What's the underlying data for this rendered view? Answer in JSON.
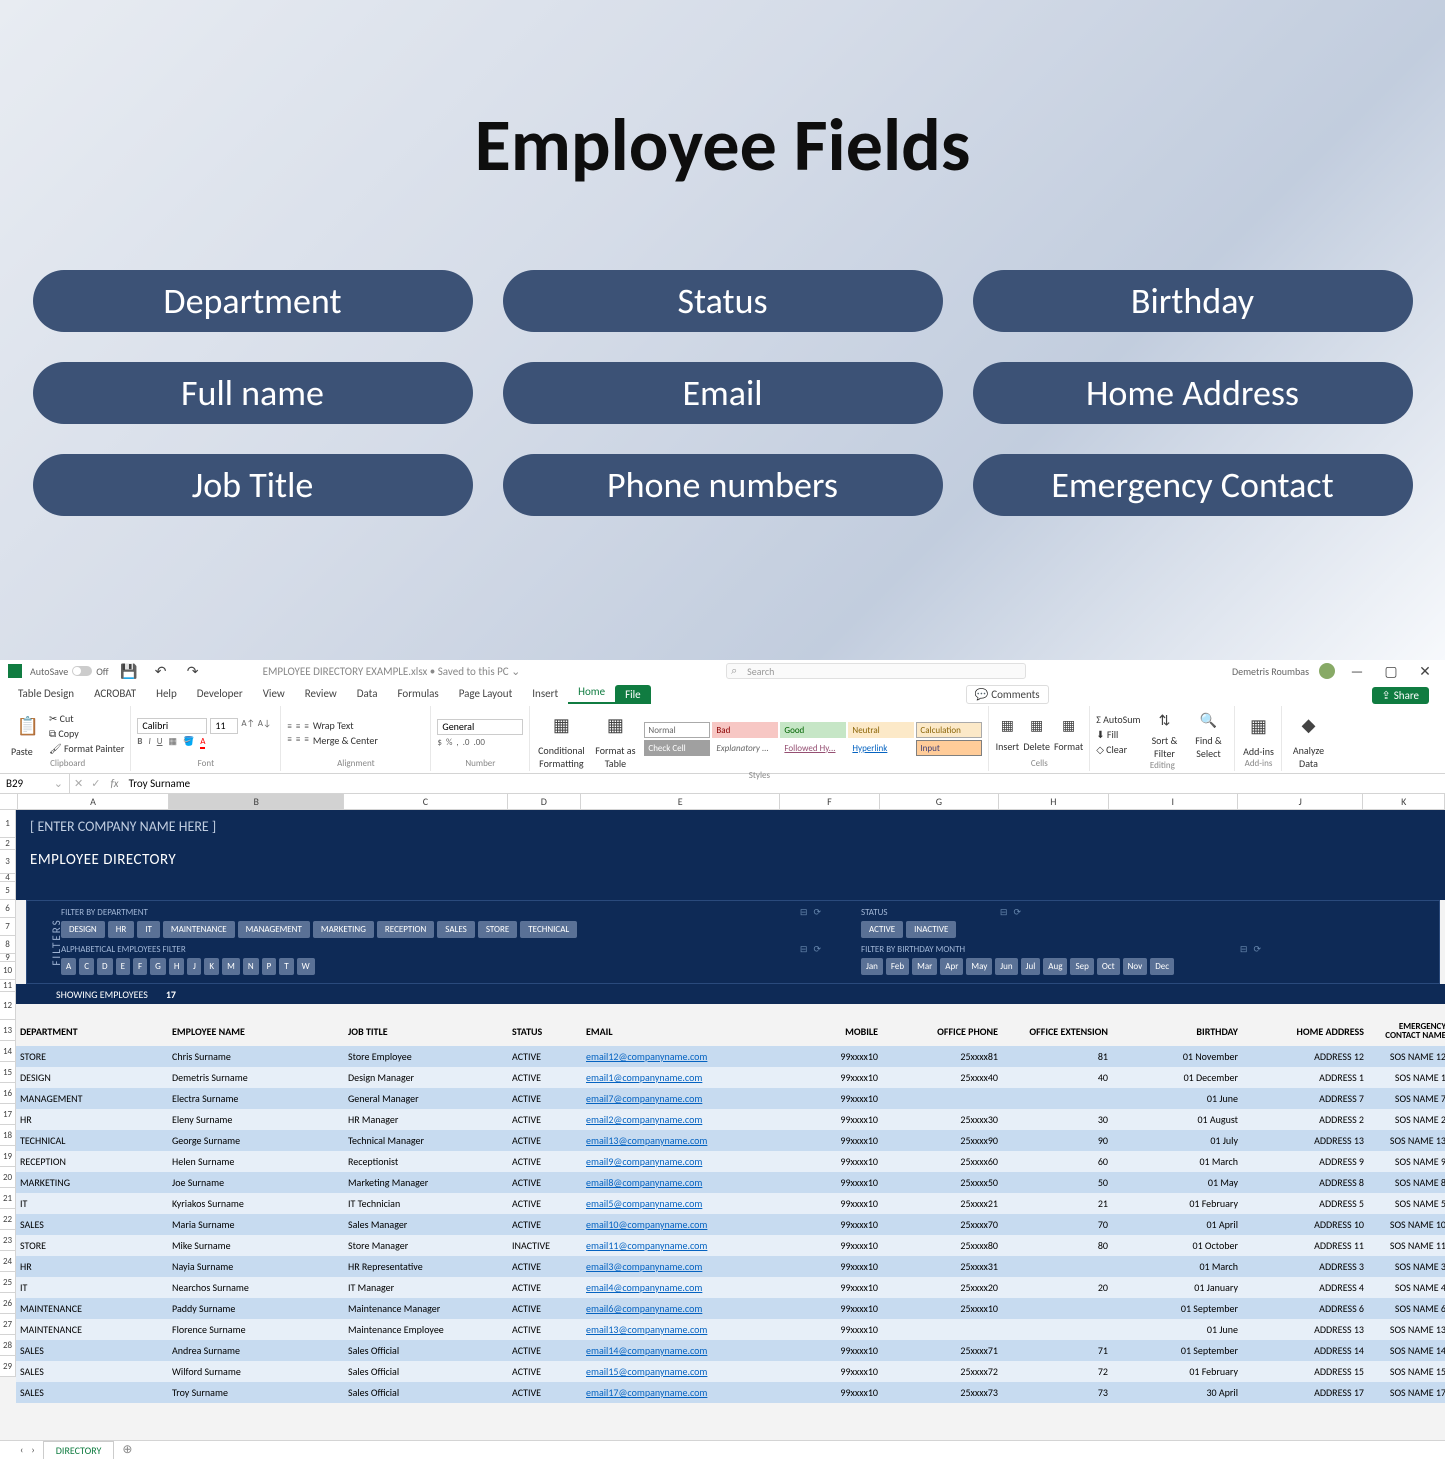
{
  "hero": {
    "title": "Employee Fields",
    "pills": [
      "Department",
      "Status",
      "Birthday",
      "Full name",
      "Email",
      "Home Address",
      "Job Title",
      "Phone numbers",
      "Emergency Contact"
    ]
  },
  "excel": {
    "autosave_label": "AutoSave",
    "doc_title": "EMPLOYEE DIRECTORY EXAMPLE.xlsx • Saved to this PC ⌄",
    "search_placeholder": "Search",
    "user_name": "Demetris Roumbas",
    "ribbon_tabs": [
      "File",
      "Home",
      "Insert",
      "Page Layout",
      "Formulas",
      "Data",
      "Review",
      "View",
      "Developer",
      "Help",
      "ACROBAT",
      "Table Design"
    ],
    "share": "Share",
    "comments": "Comments",
    "ribbon_groups": {
      "clipboard": {
        "label": "Clipboard",
        "paste": "Paste",
        "cut": "Cut",
        "copy": "Copy",
        "painter": "Format Painter"
      },
      "font": {
        "label": "Font",
        "family": "Calibri",
        "size": "11"
      },
      "alignment": {
        "label": "Alignment",
        "wrap": "Wrap Text",
        "merge": "Merge & Center"
      },
      "number": {
        "label": "Number",
        "format": "General"
      },
      "styles": {
        "label": "Styles",
        "cond": "Conditional Formatting",
        "fmt_table": "Format as Table",
        "styles_gallery": [
          [
            "Normal",
            "Bad",
            "Good",
            "Neutral",
            "Calculation"
          ],
          [
            "Check Cell",
            "Explanatory ...",
            "Followed Hy...",
            "Hyperlink",
            "Input"
          ]
        ]
      },
      "cells": {
        "label": "Cells",
        "insert": "Insert",
        "delete": "Delete",
        "format": "Format"
      },
      "editing": {
        "label": "Editing",
        "autosum": "AutoSum",
        "fill": "Fill",
        "clear": "Clear",
        "sort": "Sort & Filter",
        "find": "Find & Select"
      },
      "addins": {
        "label": "Add-ins",
        "addins": "Add-ins"
      },
      "analyze": {
        "analyze": "Analyze Data"
      }
    },
    "namebox": "B29",
    "fx": "fx",
    "formula": "Troy Surname",
    "cols": [
      "A",
      "B",
      "C",
      "D",
      "E",
      "F",
      "G",
      "H",
      "I",
      "J",
      "K"
    ]
  },
  "directory": {
    "company": "[ ENTER COMPANY NAME HERE ]",
    "title": "EMPLOYEE DIRECTORY",
    "filters_label": "FILTERS",
    "filter_dept_label": "FILTER BY DEPARTMENT",
    "depts": [
      "DESIGN",
      "HR",
      "IT",
      "MAINTENANCE",
      "MANAGEMENT",
      "MARKETING",
      "RECEPTION",
      "SALES",
      "STORE",
      "TECHNICAL"
    ],
    "status_label": "STATUS",
    "statuses": [
      "ACTIVE",
      "INACTIVE"
    ],
    "alpha_label": "ALPHABETICAL EMPLOYEES FILTER",
    "alpha": [
      "A",
      "C",
      "D",
      "E",
      "F",
      "G",
      "H",
      "J",
      "K",
      "M",
      "N",
      "P",
      "T",
      "W"
    ],
    "month_label": "FILTER BY BIRTHDAY MONTH",
    "months": [
      "Jan",
      "Feb",
      "Mar",
      "Apr",
      "May",
      "Jun",
      "Jul",
      "Aug",
      "Sep",
      "Oct",
      "Nov",
      "Dec"
    ],
    "showing_label": "SHOWING EMPLOYEES",
    "showing_count": "17",
    "columns": [
      "DEPARTMENT",
      "EMPLOYEE NAME",
      "JOB TITLE",
      "STATUS",
      "EMAIL",
      "MOBILE",
      "OFFICE PHONE",
      "OFFICE EXTENSION",
      "BIRTHDAY",
      "HOME ADDRESS",
      "EMERGENCY CONTACT NAME"
    ],
    "rows": [
      {
        "dept": "STORE",
        "name": "Chris Surname",
        "job": "Store Employee",
        "status": "ACTIVE",
        "email": "email12@companyname.com",
        "mobile": "99xxxx10",
        "ophone": "25xxxx81",
        "ext": "81",
        "bday": "01 November",
        "addr": "ADDRESS 12",
        "sos": "SOS NAME 12"
      },
      {
        "dept": "DESIGN",
        "name": "Demetris Surname",
        "job": "Design Manager",
        "status": "ACTIVE",
        "email": "email1@companyname.com",
        "mobile": "99xxxx10",
        "ophone": "25xxxx40",
        "ext": "40",
        "bday": "01 December",
        "addr": "ADDRESS 1",
        "sos": "SOS NAME 1"
      },
      {
        "dept": "MANAGEMENT",
        "name": "Electra Surname",
        "job": "General Manager",
        "status": "ACTIVE",
        "email": "email7@companyname.com",
        "mobile": "99xxxx10",
        "ophone": "",
        "ext": "",
        "bday": "01 June",
        "addr": "ADDRESS 7",
        "sos": "SOS NAME 7"
      },
      {
        "dept": "HR",
        "name": "Eleny Surname",
        "job": "HR Manager",
        "status": "ACTIVE",
        "email": "email2@companyname.com",
        "mobile": "99xxxx10",
        "ophone": "25xxxx30",
        "ext": "30",
        "bday": "01 August",
        "addr": "ADDRESS 2",
        "sos": "SOS NAME 2"
      },
      {
        "dept": "TECHNICAL",
        "name": "George Surname",
        "job": "Technical Manager",
        "status": "ACTIVE",
        "email": "email13@companyname.com",
        "mobile": "99xxxx10",
        "ophone": "25xxxx90",
        "ext": "90",
        "bday": "01 July",
        "addr": "ADDRESS 13",
        "sos": "SOS NAME 13"
      },
      {
        "dept": "RECEPTION",
        "name": "Helen Surname",
        "job": "Receptionist",
        "status": "ACTIVE",
        "email": "email9@companyname.com",
        "mobile": "99xxxx10",
        "ophone": "25xxxx60",
        "ext": "60",
        "bday": "01 March",
        "addr": "ADDRESS 9",
        "sos": "SOS NAME 9"
      },
      {
        "dept": "MARKETING",
        "name": "Joe Surname",
        "job": "Marketing Manager",
        "status": "ACTIVE",
        "email": "email8@companyname.com",
        "mobile": "99xxxx10",
        "ophone": "25xxxx50",
        "ext": "50",
        "bday": "01 May",
        "addr": "ADDRESS 8",
        "sos": "SOS NAME 8"
      },
      {
        "dept": "IT",
        "name": "Kyriakos Surname",
        "job": "IT Technician",
        "status": "ACTIVE",
        "email": "email5@companyname.com",
        "mobile": "99xxxx10",
        "ophone": "25xxxx21",
        "ext": "21",
        "bday": "01 February",
        "addr": "ADDRESS 5",
        "sos": "SOS NAME 5"
      },
      {
        "dept": "SALES",
        "name": "Maria Surname",
        "job": "Sales Manager",
        "status": "ACTIVE",
        "email": "email10@companyname.com",
        "mobile": "99xxxx10",
        "ophone": "25xxxx70",
        "ext": "70",
        "bday": "01 April",
        "addr": "ADDRESS 10",
        "sos": "SOS NAME 10"
      },
      {
        "dept": "STORE",
        "name": "Mike Surname",
        "job": "Store Manager",
        "status": "INACTIVE",
        "email": "email11@companyname.com",
        "mobile": "99xxxx10",
        "ophone": "25xxxx80",
        "ext": "80",
        "bday": "01 October",
        "addr": "ADDRESS 11",
        "sos": "SOS NAME 11"
      },
      {
        "dept": "HR",
        "name": "Nayia Surname",
        "job": "HR Representative",
        "status": "ACTIVE",
        "email": "email3@companyname.com",
        "mobile": "99xxxx10",
        "ophone": "25xxxx31",
        "ext": "",
        "bday": "01 March",
        "addr": "ADDRESS 3",
        "sos": "SOS NAME 3"
      },
      {
        "dept": "IT",
        "name": "Nearchos Surname",
        "job": "IT Manager",
        "status": "ACTIVE",
        "email": "email4@companyname.com",
        "mobile": "99xxxx10",
        "ophone": "25xxxx20",
        "ext": "20",
        "bday": "01 January",
        "addr": "ADDRESS 4",
        "sos": "SOS NAME 4"
      },
      {
        "dept": "MAINTENANCE",
        "name": "Paddy Surname",
        "job": "Maintenance Manager",
        "status": "ACTIVE",
        "email": "email6@companyname.com",
        "mobile": "99xxxx10",
        "ophone": "25xxxx10",
        "ext": "",
        "bday": "01 September",
        "addr": "ADDRESS 6",
        "sos": "SOS NAME 6"
      },
      {
        "dept": "MAINTENANCE",
        "name": "Florence Surname",
        "job": "Maintenance Employee",
        "status": "ACTIVE",
        "email": "email13@companyname.com",
        "mobile": "99xxxx10",
        "ophone": "",
        "ext": "",
        "bday": "01 June",
        "addr": "ADDRESS 13",
        "sos": "SOS NAME 13"
      },
      {
        "dept": "SALES",
        "name": "Andrea Surname",
        "job": "Sales Official",
        "status": "ACTIVE",
        "email": "email14@companyname.com",
        "mobile": "99xxxx10",
        "ophone": "25xxxx71",
        "ext": "71",
        "bday": "01 September",
        "addr": "ADDRESS 14",
        "sos": "SOS NAME 14"
      },
      {
        "dept": "SALES",
        "name": "Wilford Surname",
        "job": "Sales Official",
        "status": "ACTIVE",
        "email": "email15@companyname.com",
        "mobile": "99xxxx10",
        "ophone": "25xxxx72",
        "ext": "72",
        "bday": "01 February",
        "addr": "ADDRESS 15",
        "sos": "SOS NAME 15"
      },
      {
        "dept": "SALES",
        "name": "Troy Surname",
        "job": "Sales Official",
        "status": "ACTIVE",
        "email": "email17@companyname.com",
        "mobile": "99xxxx10",
        "ophone": "25xxxx73",
        "ext": "73",
        "bday": "30 April",
        "addr": "ADDRESS 17",
        "sos": "SOS NAME 17"
      }
    ]
  },
  "sheet_tab": "DIRECTORY"
}
